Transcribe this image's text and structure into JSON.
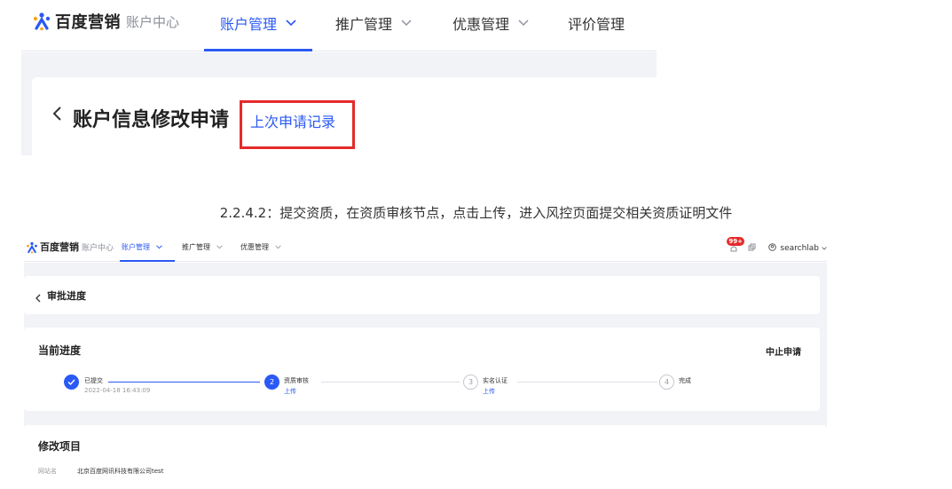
{
  "top_screenshot": {
    "brand": "百度营销",
    "brand_sub": "账户中心",
    "nav": [
      {
        "label": "账户管理",
        "chevron": "⌄",
        "active": true
      },
      {
        "label": "推广管理",
        "chevron": "⌄",
        "active": false
      },
      {
        "label": "优惠管理",
        "chevron": "⌄",
        "active": false
      },
      {
        "label": "评价管理",
        "chevron": "",
        "active": false
      }
    ],
    "back_icon": "‹",
    "page_title": "账户信息修改申请",
    "last_record_link": "上次申请记录"
  },
  "caption": "2.2.4.2：提交资质，在资质审核节点，点击上传，进入风控页面提交相关资质证明文件",
  "bottom_screenshot": {
    "brand": "百度营销",
    "brand_sub": "账户中心",
    "nav": [
      {
        "label": "账户管理",
        "chevron": "⌄",
        "active": true
      },
      {
        "label": "推广管理",
        "chevron": "⌄",
        "active": false
      },
      {
        "label": "优惠管理",
        "chevron": "⌄",
        "active": false
      }
    ],
    "notification_badge": "99+",
    "username": "searchlab",
    "user_chevron": "⌄",
    "back_title": "审批进度",
    "progress_title": "当前进度",
    "cancel_label": "中止申请",
    "steps": [
      {
        "num": "✓",
        "label": "已提交",
        "sub": "2022-04-18 16:43:09",
        "action": ""
      },
      {
        "num": "2",
        "label": "资质审核",
        "sub": "",
        "action": "上传"
      },
      {
        "num": "3",
        "label": "实名认证",
        "sub": "",
        "action": "上传"
      },
      {
        "num": "4",
        "label": "完成",
        "sub": "",
        "action": ""
      }
    ],
    "modify_title": "修改项目",
    "field_label": "网站名",
    "field_value": "北京百度网讯科技有限公司test"
  },
  "colors": {
    "accent": "#2a59f5",
    "highlight": "#e52a2a",
    "bg": "#f2f3f7"
  },
  "icons": [
    "baidu-logo-icon",
    "chevron-down-icon",
    "back-arrow-icon",
    "bell-icon",
    "copy-icon",
    "user-icon",
    "check-icon"
  ]
}
